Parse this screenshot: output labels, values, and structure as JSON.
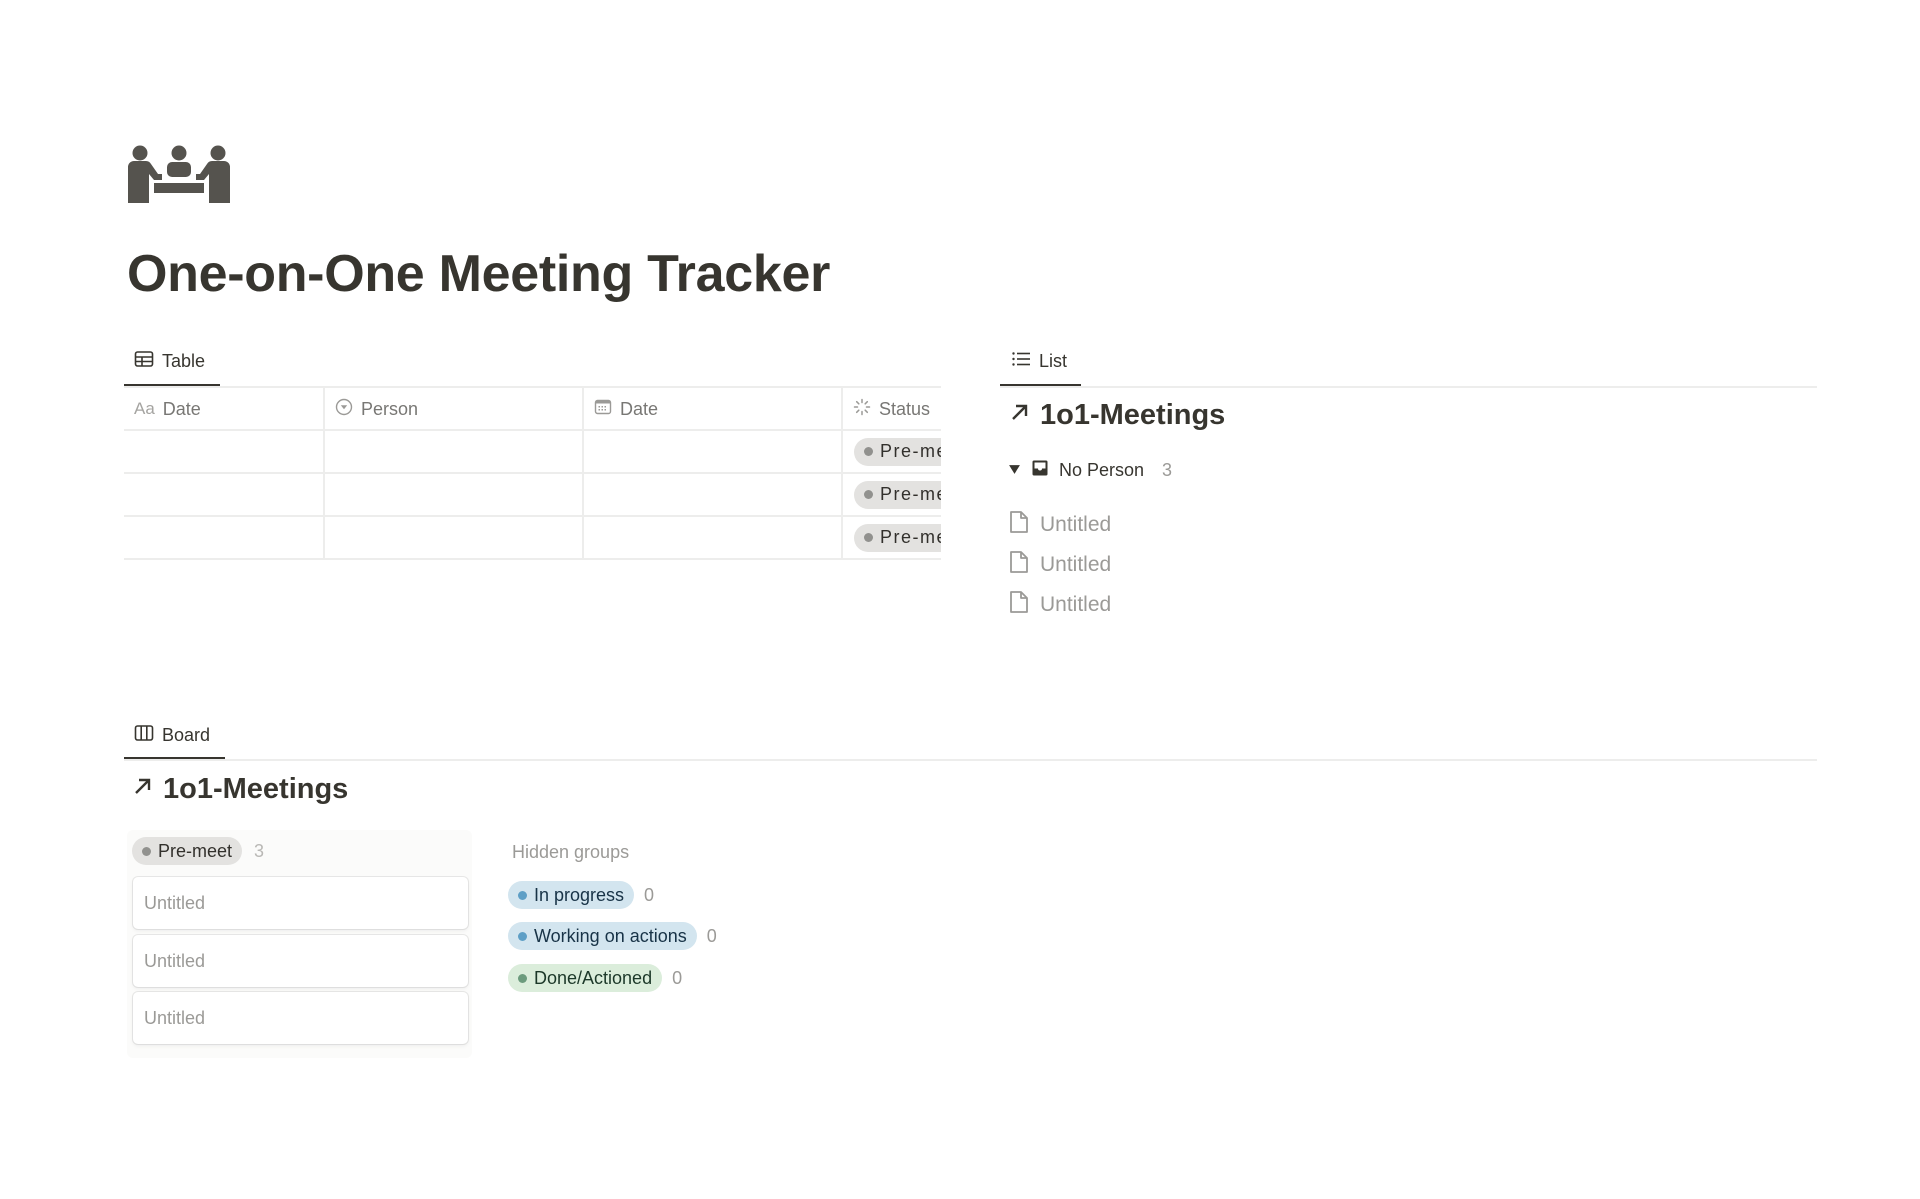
{
  "page": {
    "icon": "meeting-people-icon",
    "title": "One-on-One Meeting Tracker"
  },
  "table_view": {
    "tab_label": "Table",
    "tab_icon": "table-icon",
    "columns": [
      {
        "label": "Date",
        "icon": "title-aa-icon",
        "icon_text": "Aa"
      },
      {
        "label": "Person",
        "icon": "select-icon"
      },
      {
        "label": "Date",
        "icon": "calendar-icon"
      },
      {
        "label": "Status",
        "icon": "status-icon"
      }
    ],
    "rows": [
      {
        "title": "",
        "person": "",
        "date": "",
        "status": "Pre-meet"
      },
      {
        "title": "",
        "person": "",
        "date": "",
        "status": "Pre-meet"
      },
      {
        "title": "",
        "person": "",
        "date": "",
        "status": "Pre-meet"
      }
    ]
  },
  "list_view": {
    "tab_label": "List",
    "tab_icon": "list-icon",
    "db_title": "1o1-Meetings",
    "group": {
      "label": "No Person",
      "count": "3",
      "icon": "inbox-icon",
      "expanded": true
    },
    "items": [
      "Untitled",
      "Untitled",
      "Untitled"
    ]
  },
  "board_view": {
    "tab_label": "Board",
    "tab_icon": "board-icon",
    "db_title": "1o1-Meetings",
    "columns": [
      {
        "label": "Pre-meet",
        "count": "3",
        "color": "gray",
        "cards": [
          "Untitled",
          "Untitled",
          "Untitled"
        ]
      }
    ],
    "hidden_groups_label": "Hidden groups",
    "hidden_groups": [
      {
        "label": "In progress",
        "count": "0",
        "color": "blue"
      },
      {
        "label": "Working on actions",
        "count": "0",
        "color": "blue"
      },
      {
        "label": "Done/Actioned",
        "count": "0",
        "color": "green"
      }
    ]
  },
  "colors": {
    "text": "#37352f",
    "muted": "#9b9a97",
    "gray_tag_bg": "#e3e2e0",
    "blue_tag_bg": "#d3e5ef",
    "green_tag_bg": "#dbeddb",
    "divider": "#ededec"
  }
}
